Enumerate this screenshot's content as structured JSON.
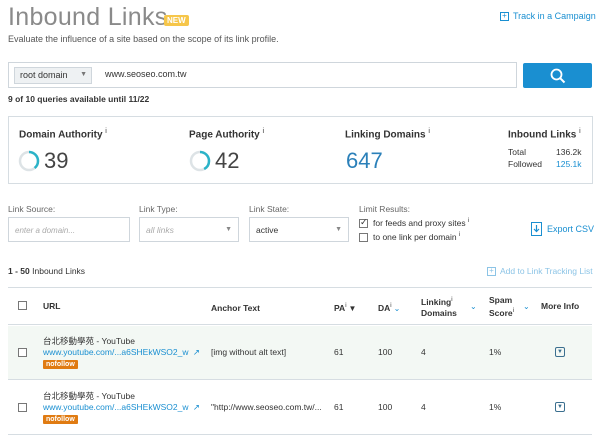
{
  "header": {
    "title": "Inbound Links",
    "badge": "NEW",
    "subtitle": "Evaluate the influence of a site based on the scope of its link profile.",
    "track_link": "Track in a Campaign"
  },
  "search": {
    "scope": "root domain",
    "query": "www.seoseo.com.tw",
    "queries_available": "9 of 10 queries available until 11/22"
  },
  "metrics": {
    "domain_authority": {
      "label": "Domain Authority",
      "value": "39",
      "fraction": 0.39
    },
    "page_authority": {
      "label": "Page Authority",
      "value": "42",
      "fraction": 0.42
    },
    "linking_domains": {
      "label": "Linking Domains",
      "value": "647"
    },
    "inbound_links": {
      "label": "Inbound Links",
      "total_label": "Total",
      "total_value": "136.2k",
      "followed_label": "Followed",
      "followed_value": "125.1k"
    },
    "info_mark": "i"
  },
  "filters": {
    "link_source": {
      "label": "Link Source:",
      "placeholder": "enter a domain..."
    },
    "link_type": {
      "label": "Link Type:",
      "value": "all links"
    },
    "link_state": {
      "label": "Link State:",
      "value": "active"
    },
    "limit": {
      "label": "Limit Results:",
      "feeds_label": "for feeds and proxy sites",
      "feeds_checked": true,
      "one_per_domain_label": "to one link per domain",
      "one_per_domain_checked": false
    },
    "export_label": "Export CSV"
  },
  "results": {
    "range": "1 - 50",
    "label": "Inbound Links",
    "add_tracking": "Add to Link Tracking List"
  },
  "table": {
    "columns": {
      "url": "URL",
      "anchor": "Anchor Text",
      "pa": "PA",
      "da": "DA",
      "linking_domains_line1": "Linking",
      "linking_domains_line2": "Domains",
      "spam_line1": "Spam",
      "spam_line2": "Score",
      "more": "More Info"
    },
    "rows": [
      {
        "title": "台北移動學苑 - YouTube",
        "url": "www.youtube.com/...a6SHEkWSO2_w",
        "tag": "nofollow",
        "anchor": "[img without alt text]",
        "pa": "61",
        "da": "100",
        "linking_domains": "4",
        "spam": "1%"
      },
      {
        "title": "台北移動學苑 - YouTube",
        "url": "www.youtube.com/...a6SHEkWSO2_w",
        "tag": "nofollow",
        "anchor": "\"http://www.seoseo.com.tw/...",
        "pa": "61",
        "da": "100",
        "linking_domains": "4",
        "spam": "1%"
      }
    ]
  },
  "colors": {
    "accent": "#1a8fd1",
    "ring": "#2bb3c8",
    "nofollow": "#e07b12",
    "badge": "#f6c64a"
  }
}
